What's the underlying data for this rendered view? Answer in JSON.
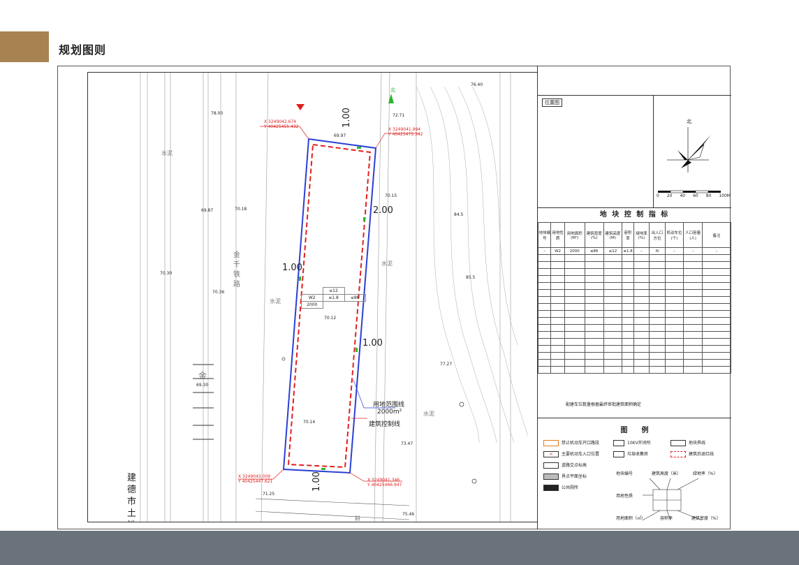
{
  "header": {
    "title": "规划图则"
  },
  "map": {
    "site_labels": {
      "boundary": "用地范围线",
      "area": "2000m²",
      "control": "建筑控制线"
    },
    "setbacks": [
      "1.00",
      "2.00",
      "1.00",
      "1.00",
      "1.00"
    ],
    "coords": [
      {
        "x": "X 3249042.674",
        "y": "Y 40425455.432"
      },
      {
        "x": "X 3249041.994",
        "y": "Y 40425475.342"
      },
      {
        "x": "X 3249043.009",
        "y": "Y 40425447.621"
      },
      {
        "x": "X 3249041.346",
        "y": "Y 40425466.947"
      }
    ],
    "elevations": [
      "78.00",
      "69.97",
      "72.71",
      "76.40",
      "70.15",
      "69.87",
      "70.18",
      "70.12",
      "70.14",
      "73.47",
      "75.46",
      "71.25",
      "69.30",
      "70.36",
      "70.30",
      "84.5",
      "85.5",
      "77.27"
    ],
    "place_labels": [
      "金千铁路",
      "水泥",
      "水泥",
      "水泥",
      "水泥",
      "金",
      "耕"
    ],
    "site_table": {
      "land_use": "W2",
      "area": "2000",
      "height": "≤12",
      "far": "≤1.8",
      "density": "≤86"
    },
    "north_label": "北",
    "vertical_text": "建德市土地"
  },
  "location": {
    "title": "位置图",
    "north": "北",
    "scale_ticks": [
      "0",
      "20",
      "40",
      "60",
      "80",
      "100M"
    ]
  },
  "control": {
    "title": "地 块 控 制 指 标",
    "headers": [
      "地块编号",
      "用地性质",
      "用地面积(M²)",
      "建筑密度(%)",
      "建筑高度(M)",
      "容积率",
      "绿地率(%)",
      "出入口方位",
      "机动车位(个)",
      "人口容量(人)",
      "备注"
    ],
    "row": [
      "–",
      "W2",
      "2000",
      "≤86",
      "≤12",
      "≤1.8",
      "–",
      "N",
      "–",
      "–",
      "–"
    ],
    "note": "配建车位数量根据最终审批建筑面积确定"
  },
  "legend": {
    "title": "图　　例",
    "items": [
      "禁止机动车开口路段",
      "10KV开闭所",
      "地块界线",
      "主要机动车入口位置",
      "垃圾收集房",
      "建筑后退红线",
      "道路交点标高",
      "界点平面坐标",
      "公共厕所"
    ],
    "diagram": {
      "top_left": "地块编号",
      "top_mid": "建筑高度（米）",
      "top_right": "绿地率（%）",
      "left": "用地性质",
      "bottom_left": "用地面积（㎡）",
      "bottom_mid": "容积率",
      "bottom_right": "建筑密度（%）"
    }
  }
}
